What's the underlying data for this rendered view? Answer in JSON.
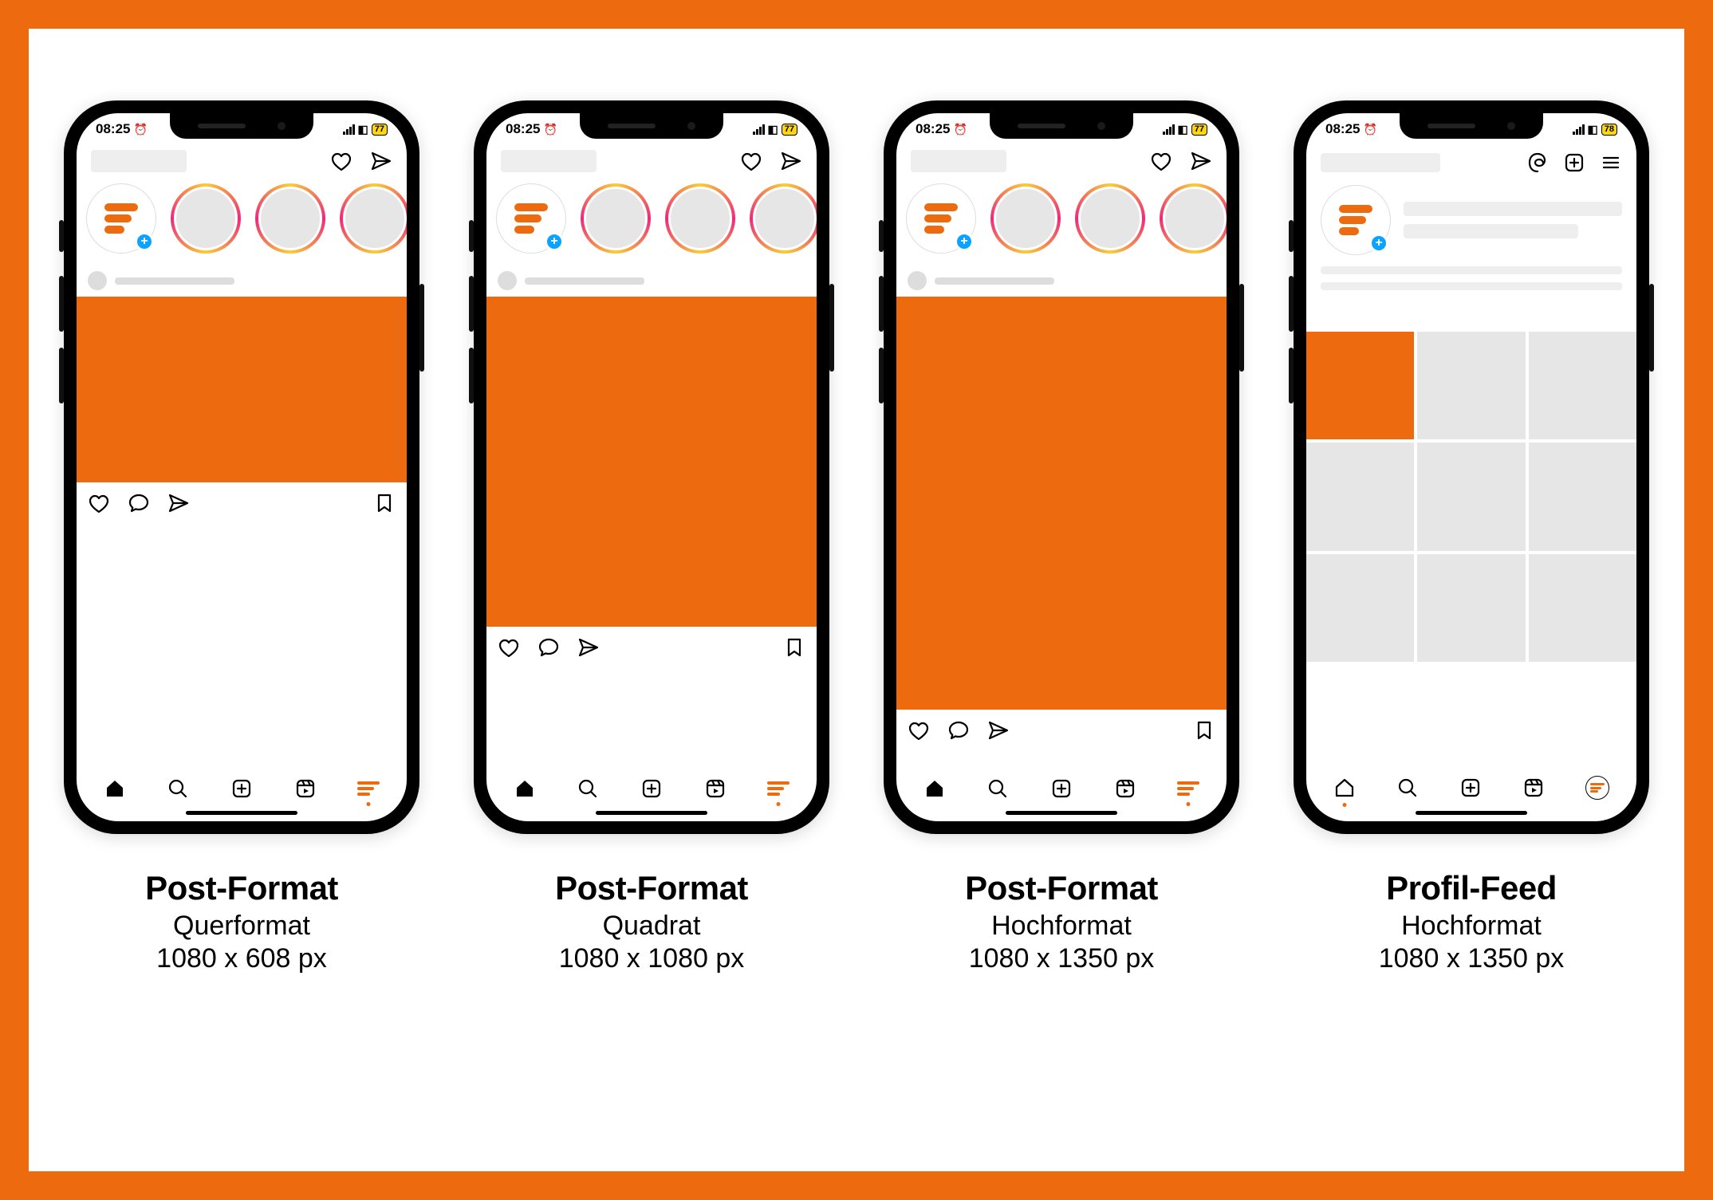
{
  "accent": "#ed6b0e",
  "status": {
    "time": "08:25",
    "alarm_glyph": "⏰",
    "battery": [
      "77",
      "77",
      "77",
      "78"
    ]
  },
  "captions": [
    {
      "title": "Post-Format",
      "subtitle": "Querformat",
      "dims": "1080 x 608 px"
    },
    {
      "title": "Post-Format",
      "subtitle": "Quadrat",
      "dims": "1080 x 1080 px"
    },
    {
      "title": "Post-Format",
      "subtitle": "Hochformat",
      "dims": "1080 x 1350 px"
    },
    {
      "title": "Profil-Feed",
      "subtitle": "Hochformat",
      "dims": "1080 x 1350 px"
    }
  ],
  "icons": {
    "heart": "heart",
    "send": "send",
    "comment": "comment",
    "bookmark": "bookmark",
    "home": "home",
    "search": "search",
    "add": "add",
    "reels": "reels",
    "threads": "threads",
    "menu": "menu",
    "plus": "+"
  }
}
